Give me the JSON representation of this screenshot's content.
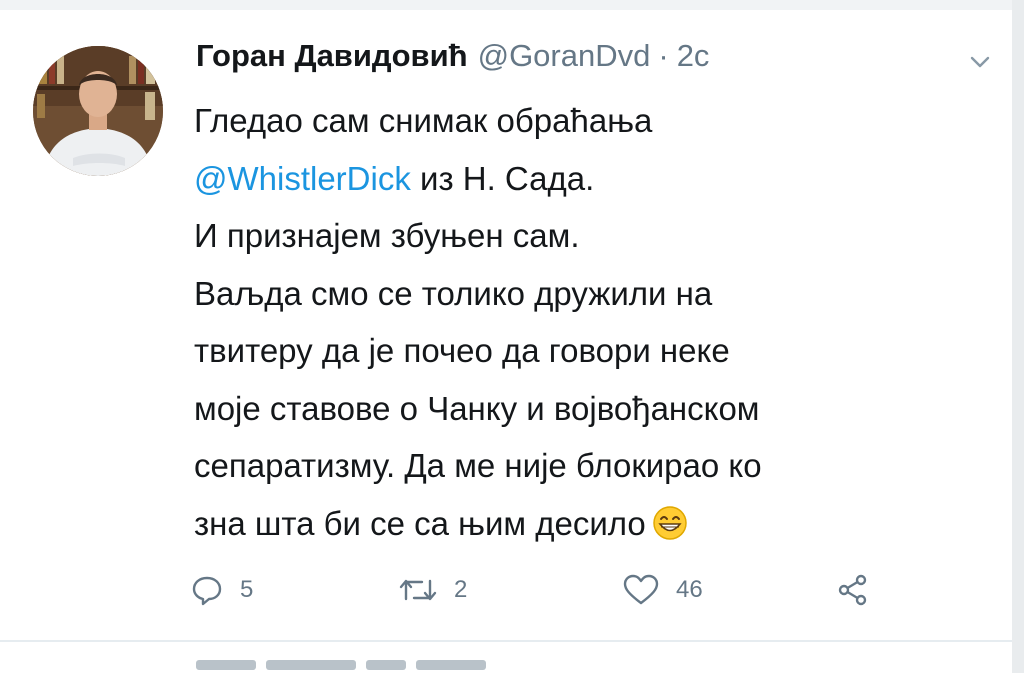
{
  "tweet": {
    "author_name": "Горан Давидовић",
    "author_handle": "@GoranDvd",
    "separator": "·",
    "timestamp": "2с",
    "text_lines": [
      "Гледао сам снимак обраћања",
      "из Н. Сада.",
      "И признајем збуњен сам.",
      "Ваљда смо се толико дружили на",
      "твитеру да је почео да говори неке",
      "моје ставове о Чанку и војвођанском",
      "сепаратизму. Да ме није блокирао ко",
      "зна шта би се са њим десило"
    ],
    "mention": "@WhistlerDick",
    "emoji": "grinning-face-emoji"
  },
  "actions": {
    "reply_count": "5",
    "retweet_count": "2",
    "like_count": "46"
  },
  "icons": {
    "reply": "reply-icon",
    "retweet": "retweet-icon",
    "like": "heart-icon",
    "share": "share-icon",
    "menu": "chevron-down-icon"
  },
  "colors": {
    "text": "#14171a",
    "secondary": "#657786",
    "link": "#1b95e0",
    "divider": "#e6ecf0"
  }
}
